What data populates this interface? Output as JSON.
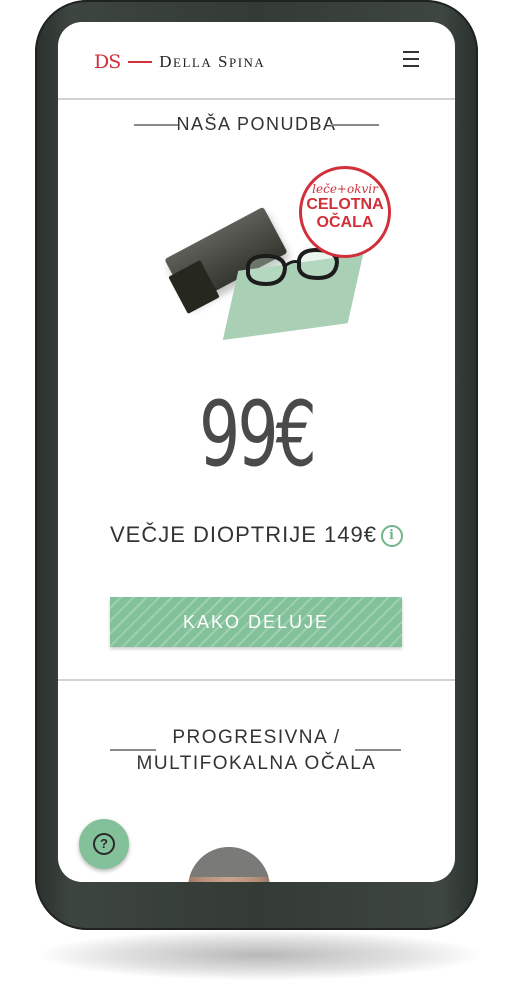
{
  "brand": {
    "mark": "DS",
    "name_initial_1": "D",
    "name_rest_1": "ELLA",
    "name_initial_2": "S",
    "name_rest_2": "PINA"
  },
  "offer": {
    "section_title": "NAŠA PONUDBA",
    "badge_line1": "leče+okvir",
    "badge_line2": "CELOTNA",
    "badge_line3": "OČALA",
    "price": "99€",
    "subtitle": "VEČJE DIOPTRIJE 149€",
    "cta_label": "KAKO DELUJE"
  },
  "progressive": {
    "title_line1": "PROGRESIVNA /",
    "title_line2": "MULTIFOKALNA OČALA"
  },
  "colors": {
    "brand_red": "#d0303a",
    "accent_green": "#83c19a",
    "phone_frame": "#343b37"
  },
  "icons": {
    "menu": "menu-icon",
    "info": "info-icon",
    "help": "help-icon"
  }
}
